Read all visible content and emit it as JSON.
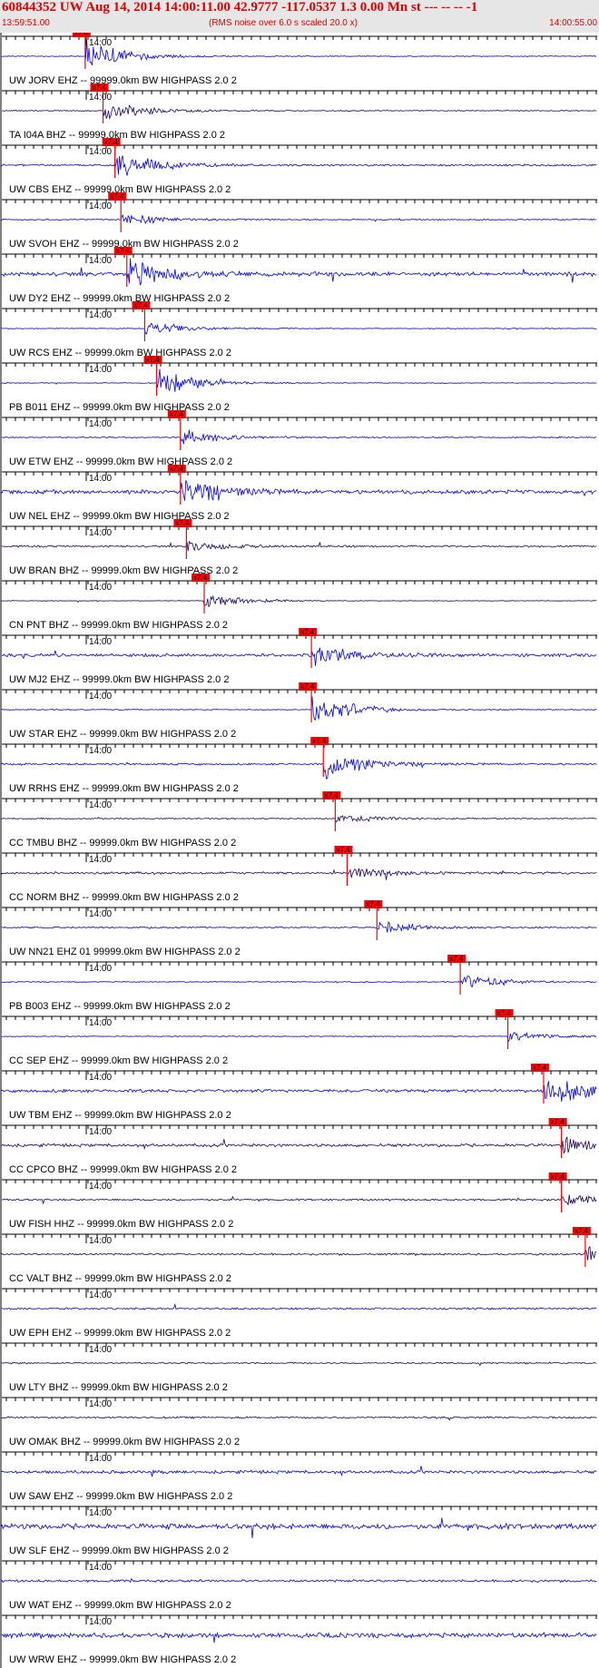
{
  "header": {
    "title": "60844352 UW Aug 14, 2014 14:00:11.00   42.9777 -117.0537  1.3 0.00 Mn st --- -- --   -1",
    "start_time": "13:59:51.00",
    "rms_note": "(RMS noise over 6.0 s scaled 20.0 x)",
    "end_time": "14:00:55.00"
  },
  "chart_data": {
    "type": "line",
    "time_window": [
      "13:59:51.00",
      "14:00:55.00"
    ],
    "minute_tick_label": "14:00",
    "pick_label": "x7.4",
    "traces": [
      {
        "label": "UW JORV EHZ -- 99999.0km BW  HIGHPASS  2.0  2",
        "pick": 0.14,
        "amp": 0.95,
        "noise": 0.05,
        "color": "#0000ee"
      },
      {
        "label": "TA I04A BHZ -- 99999.0km BW  HIGHPASS  2.0  2",
        "pick": 0.17,
        "amp": 0.7,
        "noise": 0.06,
        "color": "#1a0060"
      },
      {
        "label": "UW CBS EHZ -- 99999.0km BW  HIGHPASS  2.0  2",
        "pick": 0.19,
        "amp": 0.8,
        "noise": 0.12,
        "color": "#0000ee"
      },
      {
        "label": "UW SVOH EHZ -- 99999.0km BW  HIGHPASS  2.0  2",
        "pick": 0.2,
        "amp": 0.4,
        "noise": 0.08,
        "color": "#0000ee"
      },
      {
        "label": "UW DY2 EHZ -- 99999.0km BW  HIGHPASS  2.0  2",
        "pick": 0.21,
        "amp": 0.9,
        "noise": 0.25,
        "color": "#0000ee"
      },
      {
        "label": "UW RCS EHZ -- 99999.0km BW  HIGHPASS  2.0  2",
        "pick": 0.24,
        "amp": 0.45,
        "noise": 0.05,
        "color": "#0000ee"
      },
      {
        "label": "PB B011 EHZ -- 99999.0km BW  HIGHPASS  2.0  2",
        "pick": 0.26,
        "amp": 0.8,
        "noise": 0.05,
        "color": "#0000ee"
      },
      {
        "label": "UW ETW EHZ -- 99999.0km BW  HIGHPASS  2.0  2",
        "pick": 0.3,
        "amp": 0.5,
        "noise": 0.08,
        "color": "#0000ee"
      },
      {
        "label": "UW NEL EHZ -- 99999.0km BW  HIGHPASS  2.0  2",
        "pick": 0.3,
        "amp": 0.9,
        "noise": 0.25,
        "color": "#0000ee"
      },
      {
        "label": "UW BRAN BHZ -- 99999.0km BW  HIGHPASS  2.0  2",
        "pick": 0.31,
        "amp": 0.35,
        "noise": 0.12,
        "color": "#1a0060"
      },
      {
        "label": "CN PNT BHZ -- 99999.0km BW  HIGHPASS  2.0  2",
        "pick": 0.34,
        "amp": 0.4,
        "noise": 0.04,
        "color": "#1a0060"
      },
      {
        "label": "UW MJ2 EHZ -- 99999.0km BW  HIGHPASS  2.0  2",
        "pick": 0.52,
        "amp": 0.6,
        "noise": 0.2,
        "color": "#0000ee"
      },
      {
        "label": "UW STAR EHZ -- 99999.0km BW  HIGHPASS  2.0  2",
        "pick": 0.52,
        "amp": 0.95,
        "noise": 0.06,
        "color": "#0000ee"
      },
      {
        "label": "UW RRHS EHZ -- 99999.0km BW  HIGHPASS  2.0  2",
        "pick": 0.54,
        "amp": 0.95,
        "noise": 0.12,
        "color": "#0000ee"
      },
      {
        "label": "CC TMBU BHZ -- 99999.0km BW  HIGHPASS  2.0  2",
        "pick": 0.56,
        "amp": 0.3,
        "noise": 0.08,
        "color": "#1a0060"
      },
      {
        "label": "CC NORM BHZ -- 99999.0km BW  HIGHPASS  2.0  2",
        "pick": 0.58,
        "amp": 0.35,
        "noise": 0.15,
        "color": "#1a0060"
      },
      {
        "label": "UW NN21 EHZ 01 99999.0km BW  HIGHPASS  2.0  2",
        "pick": 0.63,
        "amp": 0.35,
        "noise": 0.1,
        "color": "#0000ee"
      },
      {
        "label": "PB B003 EHZ -- 99999.0km BW  HIGHPASS  2.0  2",
        "pick": 0.77,
        "amp": 0.5,
        "noise": 0.06,
        "color": "#0000ee"
      },
      {
        "label": "CC SEP EHZ -- 99999.0km BW  HIGHPASS  2.0  2",
        "pick": 0.85,
        "amp": 0.3,
        "noise": 0.06,
        "color": "#0000ee"
      },
      {
        "label": "UW TBM EHZ -- 99999.0km BW  HIGHPASS  2.0  2",
        "pick": 0.91,
        "amp": 0.95,
        "noise": 0.2,
        "color": "#0000ee"
      },
      {
        "label": "CC CPCO BHZ -- 99999.0km BW  HIGHPASS  2.0  2",
        "pick": 0.94,
        "amp": 0.5,
        "noise": 0.2,
        "color": "#1a0060"
      },
      {
        "label": "UW FISH HHZ -- 99999.0km BW  HIGHPASS  2.0  2",
        "pick": 0.94,
        "amp": 0.3,
        "noise": 0.12,
        "color": "#1a0060"
      },
      {
        "label": "CC VALT BHZ -- 99999.0km BW  HIGHPASS  2.0  2",
        "pick": 0.98,
        "amp": 0.4,
        "noise": 0.12,
        "color": "#1a0060"
      },
      {
        "label": "UW EPH EHZ -- 99999.0km BW  HIGHPASS  2.0  2",
        "pick": null,
        "amp": 0,
        "noise": 0.12,
        "color": "#0000ee"
      },
      {
        "label": "UW LTY BHZ -- 99999.0km BW  HIGHPASS  2.0  2",
        "pick": null,
        "amp": 0,
        "noise": 0.1,
        "color": "#1a0060"
      },
      {
        "label": "UW OMAK BHZ -- 99999.0km BW  HIGHPASS  2.0  2",
        "pick": null,
        "amp": 0,
        "noise": 0.12,
        "color": "#1a0060"
      },
      {
        "label": "UW SAW EHZ -- 99999.0km BW  HIGHPASS  2.0  2",
        "pick": null,
        "amp": 0,
        "noise": 0.2,
        "color": "#0000ee"
      },
      {
        "label": "UW SLF EHZ -- 99999.0km BW  HIGHPASS  2.0  2",
        "pick": null,
        "amp": 0,
        "noise": 0.35,
        "color": "#0000ee"
      },
      {
        "label": "UW WAT EHZ -- 99999.0km BW  HIGHPASS  2.0  2",
        "pick": null,
        "amp": 0,
        "noise": 0.15,
        "color": "#0000ee"
      },
      {
        "label": "UW WRW EHZ -- 99999.0km BW  HIGHPASS  2.0  2",
        "pick": null,
        "amp": 0,
        "noise": 0.3,
        "color": "#0000ee"
      }
    ]
  }
}
